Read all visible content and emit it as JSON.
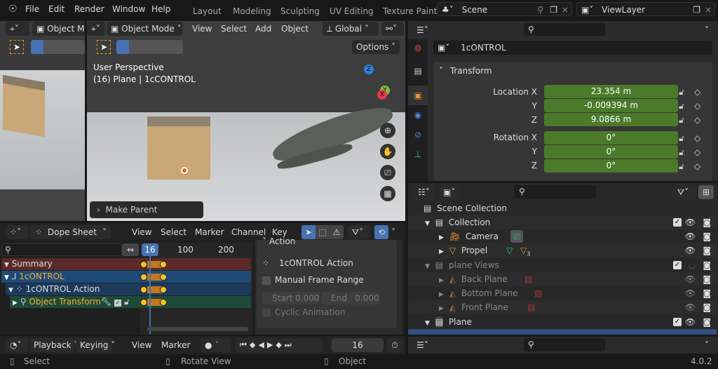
{
  "topbar": {
    "menus": [
      "File",
      "Edit",
      "Render",
      "Window",
      "Help"
    ],
    "workspaces": [
      "Layout",
      "Modeling",
      "Sculpting",
      "UV Editing",
      "Texture Paint"
    ],
    "scene": "Scene",
    "view_layer": "ViewLayer"
  },
  "viewport_left": {
    "mode": "Object Mo"
  },
  "viewport": {
    "mode": "Object Mode",
    "menus": [
      "View",
      "Select",
      "Add",
      "Object"
    ],
    "orientation": "Global",
    "options": "Options",
    "info_line1": "User Perspective",
    "info_line2": "(16) Plane | 1cCONTROL",
    "make_parent": "Make Parent",
    "gizmo": {
      "x": "X",
      "y": "Y",
      "z": "Z"
    }
  },
  "properties": {
    "object_name": "1cONTROL",
    "panel": "Transform",
    "location_label": "Location X",
    "rotation_label": "Rotation X",
    "axis_y": "Y",
    "axis_z": "Z",
    "location": [
      "23.354 m",
      "-0.009394 m",
      "9.0866 m"
    ],
    "rotation": [
      "0°",
      "0°",
      "0°"
    ]
  },
  "outliner": {
    "items": [
      {
        "label": "Scene Collection"
      },
      {
        "label": "Collection"
      },
      {
        "label": "Camera"
      },
      {
        "label": "Propel",
        "badge": "3"
      },
      {
        "label": "plane Views"
      },
      {
        "label": "Back Plane"
      },
      {
        "label": "Bottom Plane"
      },
      {
        "label": "Front Plane"
      },
      {
        "label": "Plane"
      }
    ]
  },
  "dopesheet": {
    "editor": "Dope Sheet",
    "menus": [
      "View",
      "Select",
      "Marker",
      "Channel",
      "Key"
    ],
    "current_frame": "16",
    "ruler": [
      "100",
      "200"
    ],
    "channels": [
      "Summary",
      "1cONTROL",
      "1cONTROL Action",
      "Object Transform"
    ],
    "sidebar": {
      "section": "Action",
      "action": "1cONTROL Action",
      "manual_range": "Manual Frame Range",
      "start_label": "Start",
      "start": "0.000",
      "end_label": "End",
      "end": "0.000",
      "cyclic": "Cyclic Animation"
    }
  },
  "timeline": {
    "playback": "Playback",
    "keying": "Keying",
    "menus": [
      "View",
      "Marker"
    ],
    "frame": "16"
  },
  "status": {
    "select": "Select",
    "rotate": "Rotate View",
    "object": "Object",
    "version": "4.0.2"
  },
  "colors": {
    "accent": "#4772b3",
    "field_green": "#4a7a2a",
    "keyframe": "#f5c22a"
  }
}
